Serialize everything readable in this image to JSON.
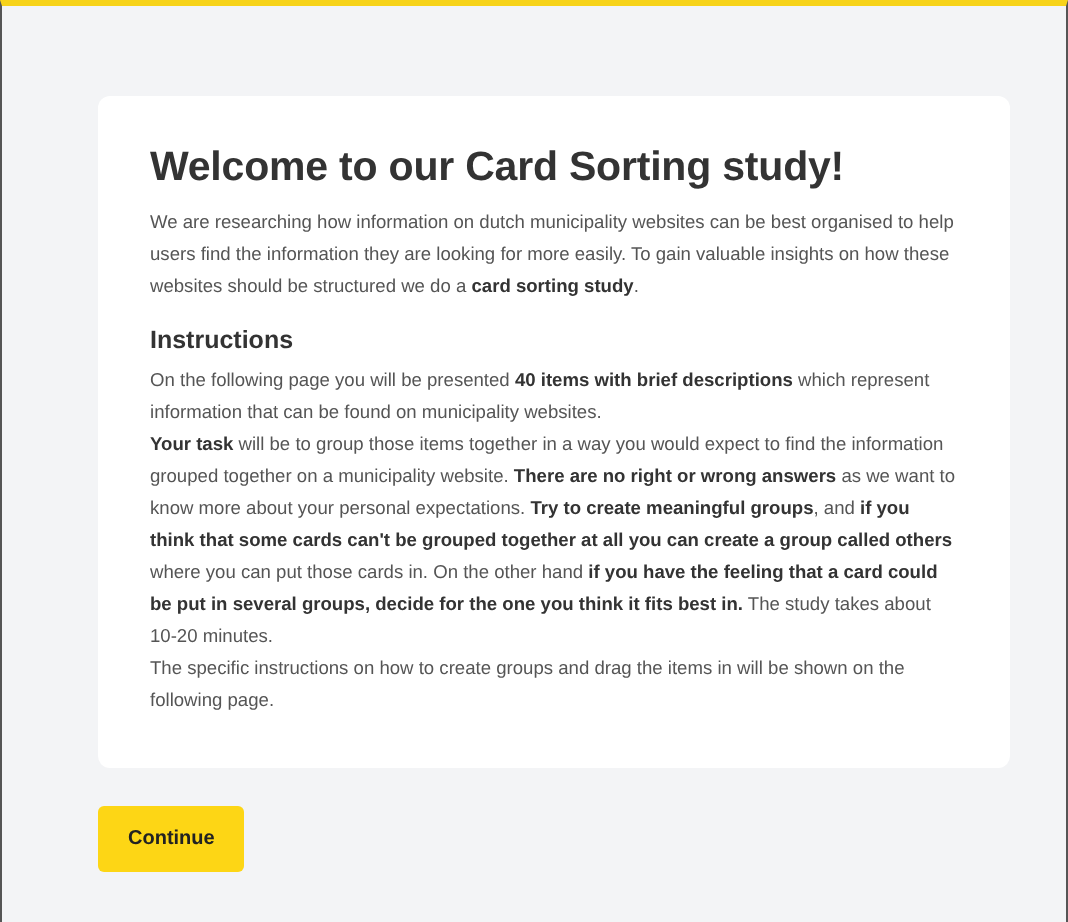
{
  "title": "Welcome to our Card Sorting study!",
  "intro": "We are researching how information on dutch municipality websites can be best organised to help users find the information they are looking for more easily. To gain valuable insights on how these websites should be structured we do a **card sorting study**.",
  "instructions": {
    "heading": "Instructions",
    "paragraphs": [
      "On the following page you will be presented **40 items with brief descriptions** which represent information that can be found on municipality websites.",
      "**Your task** will be to group those items together in a way you would expect to find the information grouped together on a municipality website. **There are no right or wrong answers** as we want to know more about your personal expectations. **Try to create meaningful groups**, and **if you think that some cards can't be grouped together at all you can create a group called others** where you can put those cards in. On the other hand **if you have the feeling that a card could be put in several groups, decide for the one you think it fits best in.** The study takes about 10-20 minutes.",
      "The specific instructions on how to create groups and drag the items in will be shown on the following page."
    ]
  },
  "button": "Continue"
}
